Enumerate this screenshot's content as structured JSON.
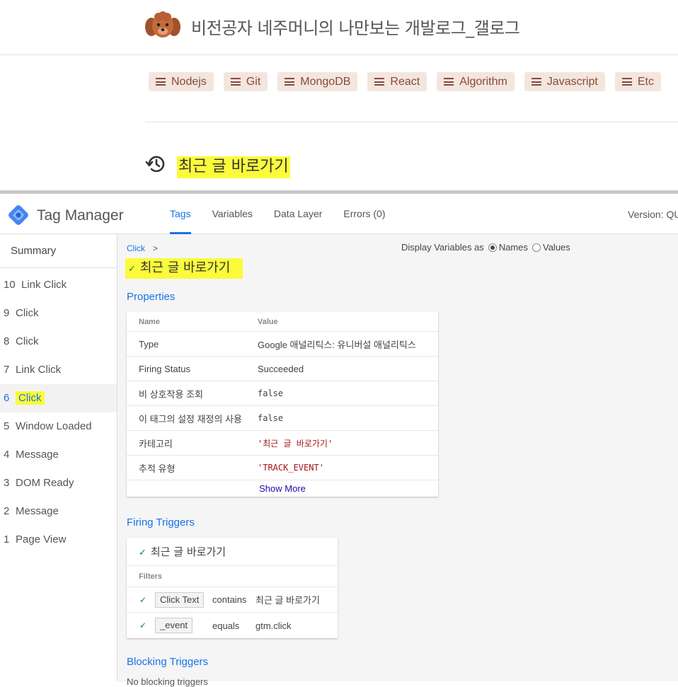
{
  "blog": {
    "title": "비전공자 네주머니의 나만보는 개발로그_갤로그",
    "categories": [
      {
        "label": "Nodejs"
      },
      {
        "label": "Git"
      },
      {
        "label": "MongoDB"
      },
      {
        "label": "React"
      },
      {
        "label": "Algorithm"
      },
      {
        "label": "Javascript"
      },
      {
        "label": "Etc"
      }
    ],
    "recent_link": "최근 글 바로가기"
  },
  "gtm": {
    "brand": "Tag Manager",
    "tabs": [
      {
        "label": "Tags",
        "active": true
      },
      {
        "label": "Variables"
      },
      {
        "label": "Data Layer"
      },
      {
        "label": "Errors (0)"
      }
    ],
    "version_label": "Version: QU",
    "sidebar": {
      "summary": "Summary",
      "events": [
        {
          "num": "10",
          "label": "Link Click"
        },
        {
          "num": "9",
          "label": "Click"
        },
        {
          "num": "8",
          "label": "Click"
        },
        {
          "num": "7",
          "label": "Link Click"
        },
        {
          "num": "6",
          "label": "Click",
          "selected": true
        },
        {
          "num": "5",
          "label": "Window Loaded"
        },
        {
          "num": "4",
          "label": "Message"
        },
        {
          "num": "3",
          "label": "DOM Ready"
        },
        {
          "num": "2",
          "label": "Message"
        },
        {
          "num": "1",
          "label": "Page View"
        }
      ]
    },
    "breadcrumb": {
      "link": "Click",
      "separator": ">"
    },
    "display_variables": {
      "label": "Display Variables as",
      "names": "Names",
      "values": "Values",
      "selected": "Names"
    },
    "tag_title": "최근 글 바로가기",
    "properties": {
      "heading": "Properties",
      "col_name": "Name",
      "col_value": "Value",
      "rows": [
        {
          "name": "Type",
          "value": "Google 애널리틱스: 유니버설 애널리틱스"
        },
        {
          "name": "Firing Status",
          "value": "Succeeded"
        },
        {
          "name": "비 상호작용 조회",
          "value": "false"
        },
        {
          "name": "이 태그의 설정 재정의 사용",
          "value": "false"
        },
        {
          "name": "카테고리",
          "value": "'최근 글 바로가기'"
        },
        {
          "name": "추적 유형",
          "value": "'TRACK_EVENT'"
        }
      ],
      "show_more": "Show More"
    },
    "firing_triggers": {
      "heading": "Firing Triggers",
      "trigger_name": "최근 글 바로가기",
      "filters_label": "Filters",
      "filters": [
        {
          "variable": "Click Text",
          "operator": "contains",
          "value": "최근 글 바로가기"
        },
        {
          "variable": "_event",
          "operator": "equals",
          "value": "gtm.click"
        }
      ]
    },
    "blocking_triggers": {
      "heading": "Blocking Triggers",
      "empty_text": "No blocking triggers"
    }
  },
  "colors": {
    "accent": "#1a73e8",
    "highlight": "#fbfb3c",
    "category_bg": "#f2e6dd",
    "category_text": "#8a4a3a",
    "success": "#188038"
  }
}
